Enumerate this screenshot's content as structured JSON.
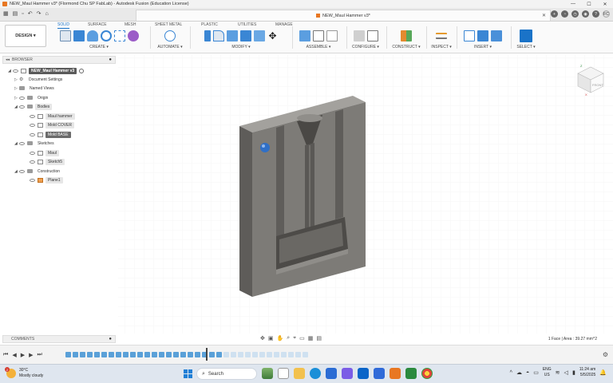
{
  "window": {
    "title": "NEW_Maul Hammer v3* (Flormond Chu SP FabLab) - Autodesk Fusion (Education License)",
    "controls": [
      "—",
      "☐",
      "✕"
    ]
  },
  "tabbar": {
    "doc_tab_title": "NEW_Maul Hammer v3*",
    "avatar": "FC"
  },
  "toolbar": {
    "design_label": "DESIGN ▾",
    "workspace_tabs": [
      "SOLID",
      "SURFACE",
      "MESH",
      "SHEET METAL",
      "PLASTIC",
      "UTILITIES",
      "MANAGE"
    ],
    "groups": [
      {
        "label": "CREATE ▾"
      },
      {
        "label": "AUTOMATE ▾"
      },
      {
        "label": "MODIFY ▾"
      },
      {
        "label": "ASSEMBLE ▾"
      },
      {
        "label": "CONFIGURE ▾"
      },
      {
        "label": "CONSTRUCT ▾"
      },
      {
        "label": "INSPECT ▾"
      },
      {
        "label": "INSERT ▾"
      },
      {
        "label": "SELECT ▾"
      }
    ]
  },
  "browser": {
    "title": "BROWSER",
    "items": [
      {
        "label": "NEW_Maul Hammer v3"
      },
      {
        "label": "Document Settings"
      },
      {
        "label": "Named Views"
      },
      {
        "label": "Origin"
      },
      {
        "label": "Bodies"
      },
      {
        "label": "Maul hammer"
      },
      {
        "label": "Mold COVER"
      },
      {
        "label": "Mold BASE"
      },
      {
        "label": "Sketches"
      },
      {
        "label": "Maul"
      },
      {
        "label": "Sketch5"
      },
      {
        "label": "Construction"
      },
      {
        "label": "Plane1"
      }
    ]
  },
  "comments": {
    "title": "COMMENTS"
  },
  "status": {
    "selection": "1 Face | Area : 39.27 mm^2"
  },
  "viewcube": {
    "face_label": "FRONT",
    "axes": [
      "Z",
      "X"
    ]
  },
  "taskbar": {
    "weather_temp": "30°C",
    "weather_desc": "Mostly cloudy",
    "weather_badge": "2",
    "search_placeholder": "Search",
    "lang_line1": "ENG",
    "lang_line2": "US",
    "time": "11:24 am",
    "date": "5/5/2025"
  },
  "colors": {
    "accent": "#1a73c8",
    "mold_front": "#7d7b77",
    "mold_side": "#5e5c59",
    "mold_top": "#a3a19d"
  }
}
